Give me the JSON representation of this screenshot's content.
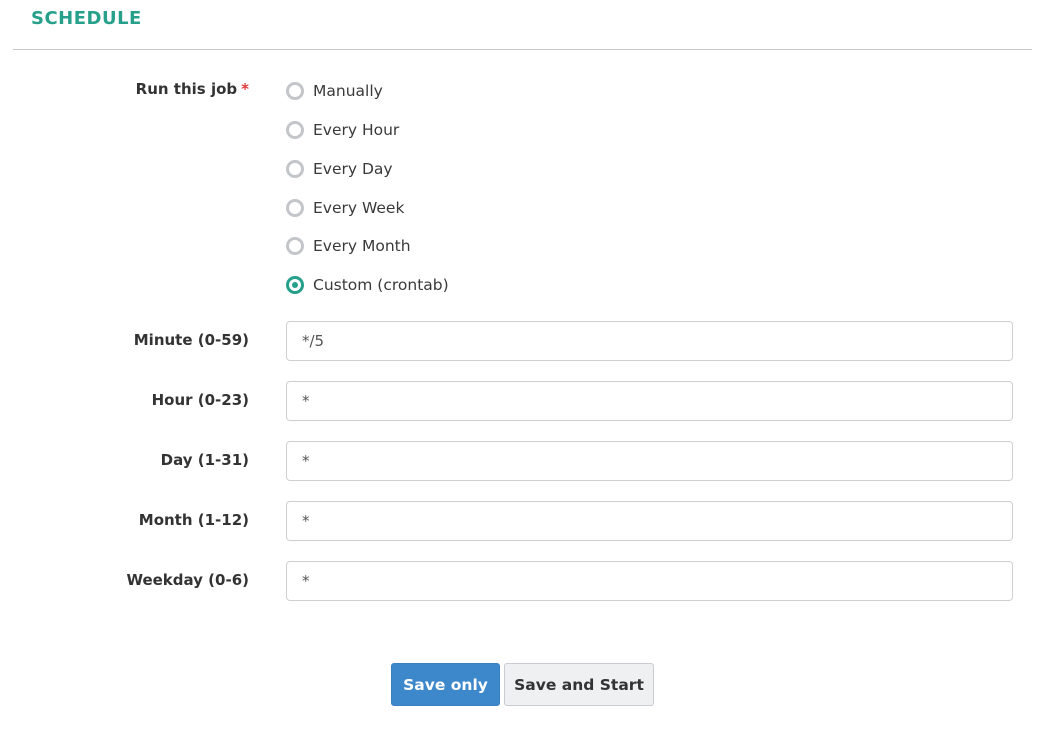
{
  "section": {
    "title": "SCHEDULE"
  },
  "run_job": {
    "label": "Run this job",
    "required_marker": "*",
    "options": [
      {
        "label": "Manually",
        "checked": false
      },
      {
        "label": "Every Hour",
        "checked": false
      },
      {
        "label": "Every Day",
        "checked": false
      },
      {
        "label": "Every Week",
        "checked": false
      },
      {
        "label": "Every Month",
        "checked": false
      },
      {
        "label": "Custom (crontab)",
        "checked": true
      }
    ]
  },
  "crontab": {
    "minute": {
      "label": "Minute (0-59)",
      "value": "*/5"
    },
    "hour": {
      "label": "Hour (0-23)",
      "value": "*"
    },
    "day": {
      "label": "Day (1-31)",
      "value": "*"
    },
    "month": {
      "label": "Month (1-12)",
      "value": "*"
    },
    "weekday": {
      "label": "Weekday (0-6)",
      "value": "*"
    }
  },
  "buttons": {
    "save_only": "Save only",
    "save_and_start": "Save and Start"
  },
  "colors": {
    "accent": "#26a08a",
    "primary_button": "#3d87cb",
    "required": "#e03a3a"
  }
}
